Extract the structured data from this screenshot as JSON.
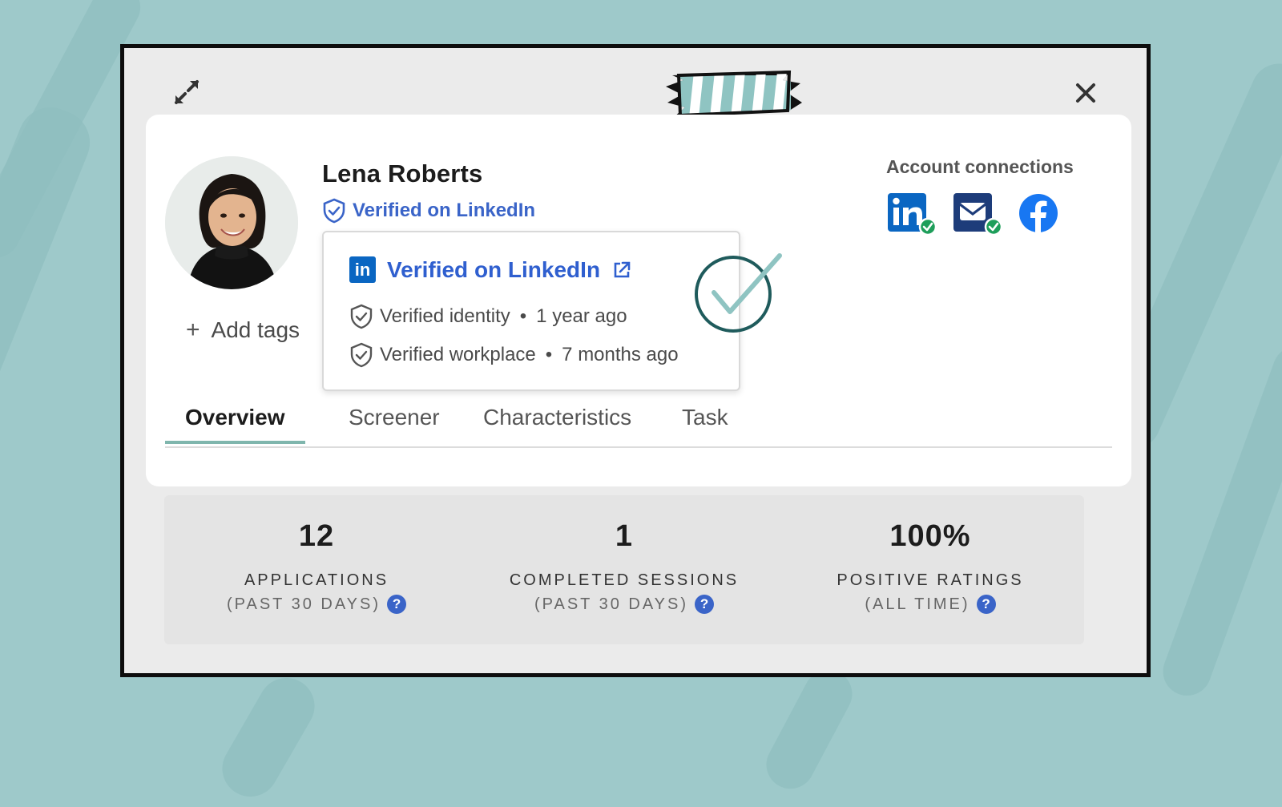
{
  "profile": {
    "name": "Lena Roberts",
    "verified_label": "Verified on LinkedIn",
    "add_tags_label": "Add tags"
  },
  "popover": {
    "title": "Verified on LinkedIn",
    "rows": [
      {
        "label": "Verified identity",
        "separator": "•",
        "time": "1 year ago"
      },
      {
        "label": "Verified workplace",
        "separator": "•",
        "time": "7 months ago"
      }
    ]
  },
  "account_connections": {
    "title": "Account connections",
    "items": [
      {
        "icon": "linkedin-icon",
        "verified": true
      },
      {
        "icon": "email-icon",
        "verified": true
      },
      {
        "icon": "facebook-icon",
        "verified": false
      }
    ]
  },
  "tabs": [
    {
      "label": "Overview",
      "active": true
    },
    {
      "label": "Screener",
      "active": false
    },
    {
      "label": "Characteristics",
      "active": false
    },
    {
      "label": "Task",
      "active": false
    }
  ],
  "stats": [
    {
      "value": "12",
      "label": "APPLICATIONS",
      "sub": "(PAST 30 DAYS)"
    },
    {
      "value": "1",
      "label": "COMPLETED SESSIONS",
      "sub": "(PAST 30 DAYS)"
    },
    {
      "value": "100%",
      "label": "POSITIVE RATINGS",
      "sub": "(ALL TIME)"
    }
  ],
  "colors": {
    "background": "#9ec9ca",
    "accent_blue": "#3a64c8",
    "linkedin_blue": "#0a66c2",
    "email_navy": "#1d3c7a",
    "facebook_blue": "#1877f2",
    "verified_green": "#1e9e5a",
    "tab_underline": "#7fb6ad",
    "check_teal": "#1f5b5c"
  }
}
